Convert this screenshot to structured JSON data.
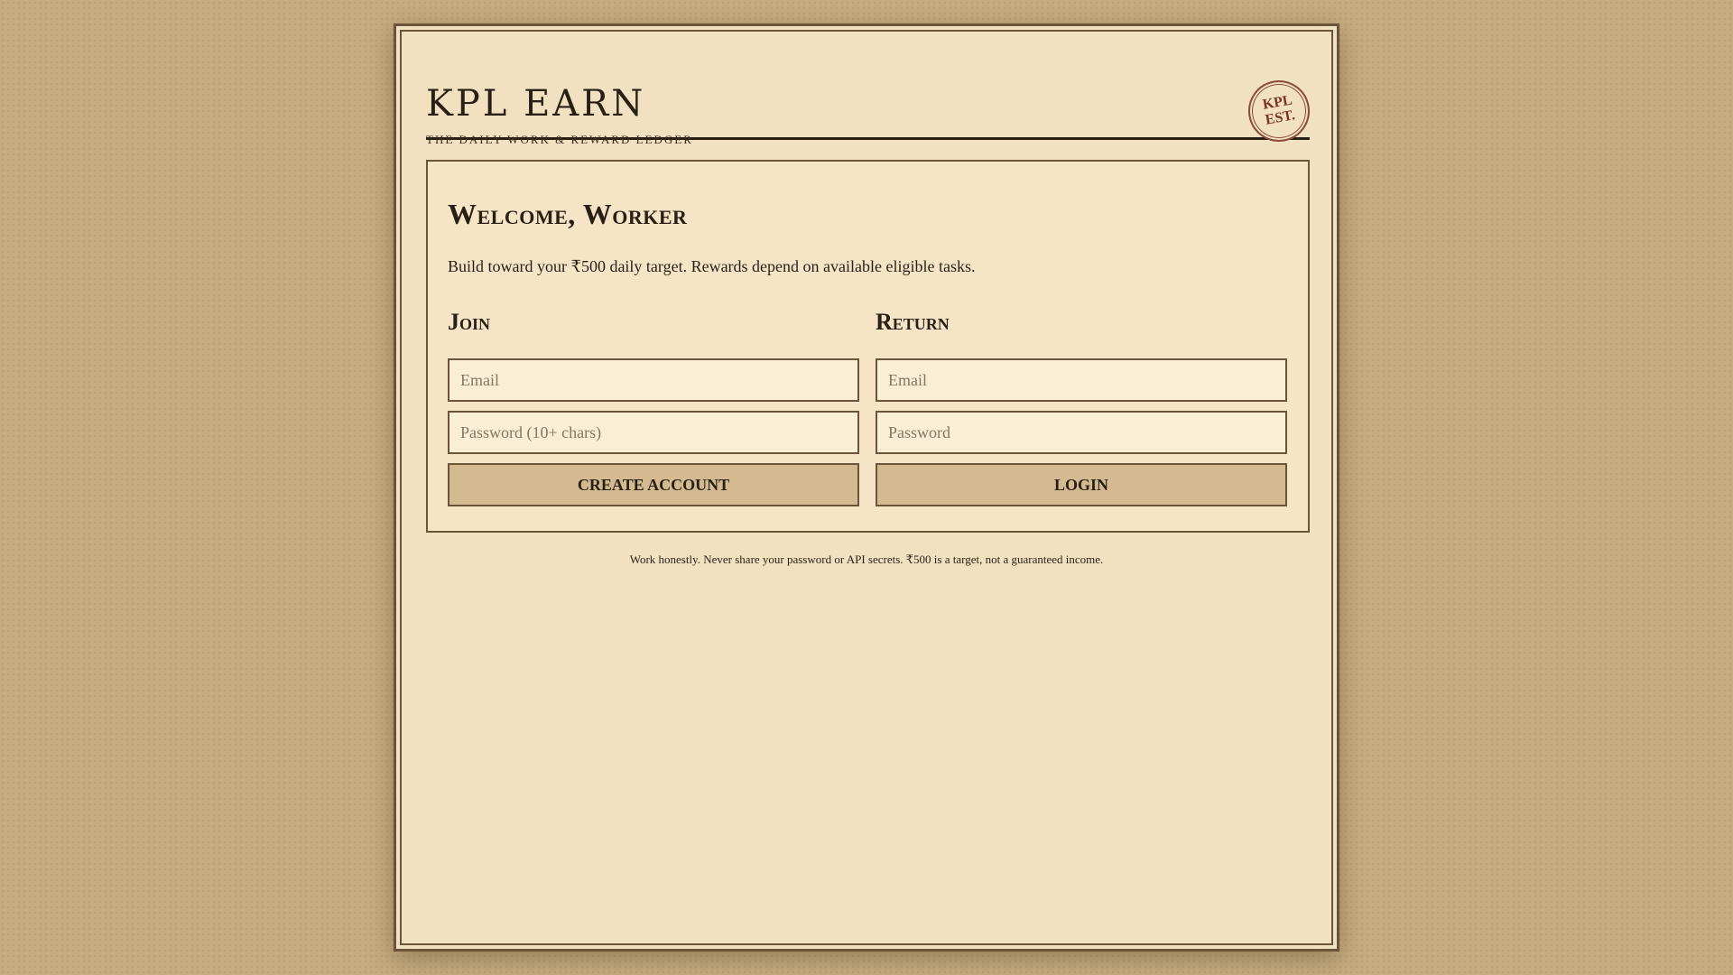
{
  "header": {
    "title": "KPL EARN",
    "subtitle": "THE DAILY WORK & REWARD LEDGER",
    "seal_line1": "KPL",
    "seal_line2": "EST."
  },
  "welcome": {
    "title": "Welcome, Worker",
    "intro": "Build toward your ₹500 daily target. Rewards depend on available eligible tasks."
  },
  "join": {
    "heading": "Join",
    "email_placeholder": "Email",
    "password_placeholder": "Password (10+ chars)",
    "submit_label": "CREATE ACCOUNT"
  },
  "return": {
    "heading": "Return",
    "email_placeholder": "Email",
    "password_placeholder": "Password",
    "submit_label": "LOGIN"
  },
  "footer": {
    "note": "Work honestly. Never share your password or API secrets. ₹500 is a target, not a guaranteed income."
  },
  "colors": {
    "background": "#c6ad80",
    "paper": "#f1e1c1",
    "ink": "#2a1f14",
    "border": "#6b5439",
    "button": "#d3ba90",
    "seal": "#8a4b3a"
  }
}
